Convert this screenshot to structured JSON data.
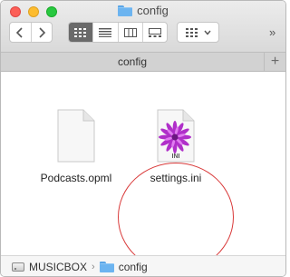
{
  "window": {
    "title": "config"
  },
  "toolbar": {
    "back_icon": "chevron-left-icon",
    "forward_icon": "chevron-right-icon",
    "views": [
      "icon-view-icon",
      "list-view-icon",
      "column-view-icon",
      "gallery-view-icon"
    ],
    "active_view": "icon-view-icon",
    "arrange_icon": "arrange-grid-icon",
    "overflow_label": "»"
  },
  "tabbar": {
    "title": "config",
    "add_label": "+"
  },
  "files": [
    {
      "name": "Podcasts.opml",
      "icon": "document-icon"
    },
    {
      "name": "settings.ini",
      "icon": "ini-file-icon",
      "badge": "INI"
    }
  ],
  "pathbar": {
    "items": [
      {
        "label": "MUSICBOX",
        "icon": "drive-icon"
      },
      {
        "label": "config",
        "icon": "folder-icon"
      }
    ],
    "separator": "›"
  },
  "colors": {
    "highlight": "#d93a3a",
    "folder": "#6cb4f0",
    "active_view": "#6a6a6a"
  }
}
